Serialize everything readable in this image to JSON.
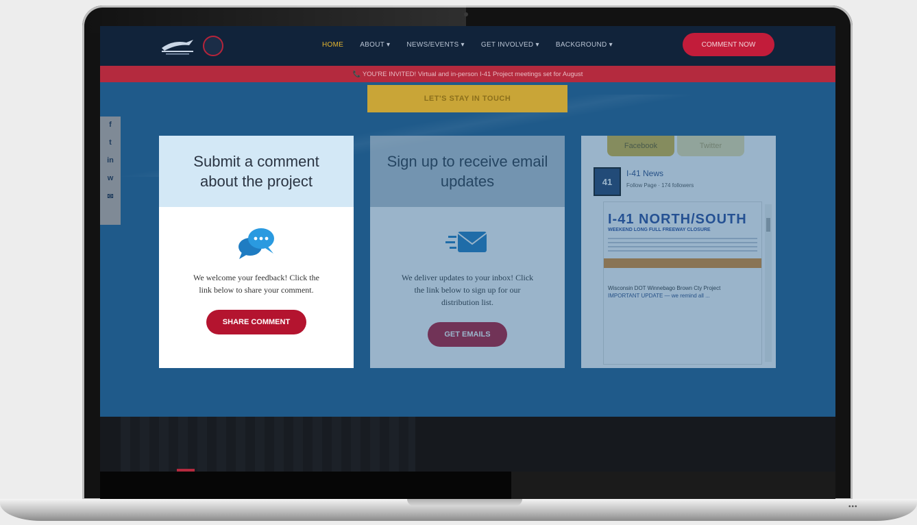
{
  "nav": {
    "logo_text": "I-41 Project",
    "links": [
      "HOME",
      "ABOUT ▾",
      "NEWS/EVENTS ▾",
      "GET INVOLVED ▾",
      "BACKGROUND ▾"
    ],
    "cta": "COMMENT NOW"
  },
  "alert": {
    "text": "📞 YOU'RE INVITED! Virtual and in-person I-41 Project meetings set for August"
  },
  "stay_in_touch": "LET'S STAY IN TOUCH",
  "share_bar": [
    "f",
    "t",
    "in",
    "w",
    "✉"
  ],
  "cards": [
    {
      "title": "Submit a comment about the project",
      "text": "We welcome your feedback! Click the link below to share your comment.",
      "button": "SHARE COMMENT"
    },
    {
      "title": "Sign up to receive email updates",
      "text": "We deliver updates to your inbox! Click the link below to sign up for our distribution list.",
      "button": "GET EMAILS"
    }
  ],
  "facebook": {
    "tabs": [
      "Facebook",
      "Twitter"
    ],
    "page_name": "I-41 News",
    "page_meta": "Follow Page · 174 followers",
    "avatar": "41",
    "post_headline": "I-41 NORTH/SOUTH",
    "post_sub": "WEEKEND LONG FULL FREEWAY CLOSURE",
    "post_caption_1": "Wisconsin DOT Winnebago Brown Cty Project",
    "post_caption_2": "IMPORTANT UPDATE — we remind all ..."
  },
  "colors": {
    "nav_bg": "#11233a",
    "accent_red": "#c21c3a",
    "accent_gold": "#c9a537",
    "screen_bg": "#1f5a8a"
  }
}
